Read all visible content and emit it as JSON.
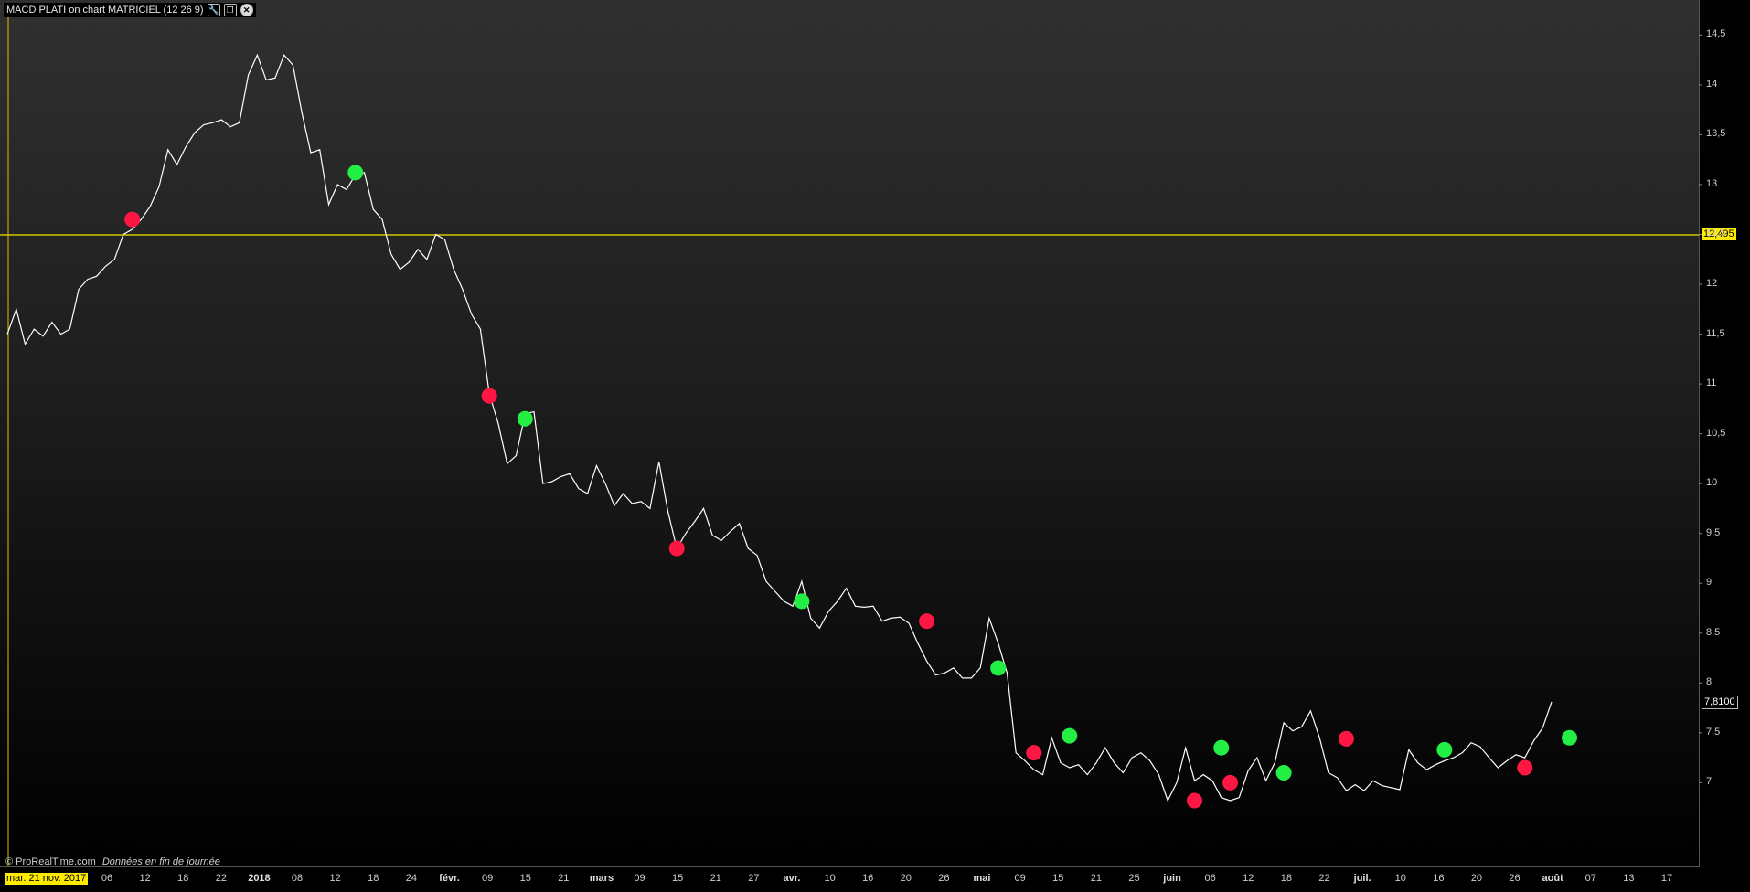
{
  "window": {
    "title": "MACD PLATI on chart MATRICIEL (12 26 9)",
    "icons": [
      "wrench-icon",
      "restore-window-icon",
      "close-icon"
    ]
  },
  "footer": {
    "copyright": "© ProRealTime.com",
    "note": "Données en fin de journée"
  },
  "cursor_date": "mar. 21 nov. 2017",
  "horizontal_line": {
    "value": 12.495,
    "label": "12,495",
    "color": "#d4c400"
  },
  "last_price": {
    "value": 7.81,
    "label": "7,8100"
  },
  "colors": {
    "line": "#ffffff",
    "buy_signal": "#22ee44",
    "sell_signal": "#ff1744",
    "hline": "#d4c400"
  },
  "chart_data": {
    "type": "line",
    "series": [
      {
        "values": [
          11.5,
          11.75,
          11.4,
          11.55,
          11.48,
          11.62,
          11.5,
          11.55,
          11.95,
          12.05,
          12.08,
          12.18,
          12.25,
          12.5,
          12.55,
          12.65,
          12.78,
          12.98,
          13.35,
          13.2,
          13.38,
          13.52,
          13.6,
          13.62,
          13.65,
          13.58,
          13.62,
          14.1,
          14.3,
          14.05,
          14.07,
          14.3,
          14.2,
          13.72,
          13.32,
          13.35,
          12.8,
          13.0,
          12.95,
          13.1,
          13.12,
          12.75,
          12.65,
          12.3,
          12.15,
          12.22,
          12.35,
          12.25,
          12.5,
          12.45,
          12.15,
          11.95,
          11.7,
          11.55,
          10.9,
          10.6,
          10.2,
          10.28,
          10.7,
          10.72,
          10.0,
          10.02,
          10.07,
          10.1,
          9.95,
          9.9,
          10.18,
          10.0,
          9.78,
          9.9,
          9.8,
          9.82,
          9.75,
          10.22,
          9.72,
          9.35,
          9.5,
          9.62,
          9.75,
          9.48,
          9.43,
          9.52,
          9.6,
          9.35,
          9.28,
          9.02,
          8.92,
          8.82,
          8.77,
          9.02,
          8.65,
          8.55,
          8.72,
          8.82,
          8.95,
          8.77,
          8.76,
          8.77,
          8.62,
          8.65,
          8.66,
          8.6,
          8.4,
          8.22,
          8.08,
          8.1,
          8.15,
          8.05,
          8.05,
          8.15,
          8.65,
          8.4,
          8.1,
          7.3,
          7.22,
          7.13,
          7.08,
          7.45,
          7.2,
          7.15,
          7.18,
          7.08,
          7.2,
          7.35,
          7.2,
          7.1,
          7.25,
          7.3,
          7.22,
          7.08,
          6.82,
          7.0,
          7.35,
          7.02,
          7.08,
          7.02,
          6.85,
          6.82,
          6.85,
          7.12,
          7.25,
          7.02,
          7.2,
          7.6,
          7.52,
          7.56,
          7.72,
          7.45,
          7.1,
          7.05,
          6.92,
          6.98,
          6.92,
          7.02,
          6.97,
          6.95,
          6.93,
          7.33,
          7.2,
          7.13,
          7.18,
          7.22,
          7.25,
          7.3,
          7.4,
          7.36,
          7.25,
          7.15,
          7.22,
          7.28,
          7.25,
          7.42,
          7.55,
          7.81
        ]
      }
    ],
    "signals": {
      "buy": [
        [
          39,
          13.12
        ],
        [
          58,
          10.65
        ],
        [
          89,
          8.82
        ],
        [
          111,
          8.15
        ],
        [
          119,
          7.47
        ],
        [
          136,
          7.35
        ],
        [
          143,
          7.1
        ],
        [
          161,
          7.33
        ],
        [
          175,
          7.45
        ]
      ],
      "sell": [
        [
          14,
          12.65
        ],
        [
          54,
          10.88
        ],
        [
          75,
          9.35
        ],
        [
          103,
          8.62
        ],
        [
          115,
          7.3
        ],
        [
          133,
          6.82
        ],
        [
          137,
          7.0
        ],
        [
          150,
          7.44
        ],
        [
          170,
          7.15
        ]
      ]
    },
    "ylim": [
      6.6,
      14.65
    ],
    "yticks": [
      "14,5",
      "14",
      "13,5",
      "13",
      "12,5",
      "12",
      "11,5",
      "11",
      "10,5",
      "10",
      "9,5",
      "9",
      "8,5",
      "8",
      "7,5",
      "7"
    ],
    "xticks": [
      "06",
      "12",
      "18",
      "22",
      "2018",
      "08",
      "12",
      "18",
      "24",
      "févr.",
      "09",
      "15",
      "21",
      "mars",
      "09",
      "15",
      "21",
      "27",
      "avr.",
      "10",
      "16",
      "20",
      "26",
      "mai",
      "09",
      "15",
      "21",
      "25",
      "juin",
      "06",
      "12",
      "18",
      "22",
      "juil.",
      "10",
      "16",
      "20",
      "26",
      "août",
      "07",
      "13",
      "17"
    ],
    "month_ticks": [
      "2018",
      "févr.",
      "mars",
      "avr.",
      "mai",
      "juin",
      "juil.",
      "août"
    ],
    "grid": false
  }
}
